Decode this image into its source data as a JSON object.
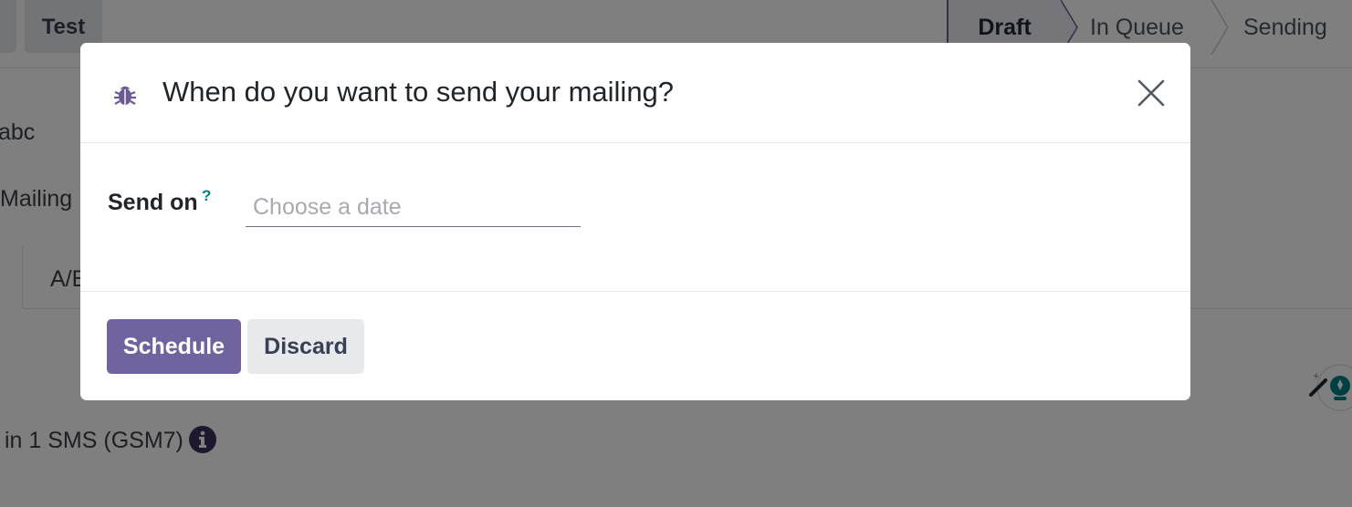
{
  "background": {
    "toolbar": {
      "test_label": "Test"
    },
    "statusbar": {
      "steps": [
        {
          "label": "Draft"
        },
        {
          "label": "In Queue"
        },
        {
          "label": "Sending"
        }
      ]
    },
    "field_fragment_abc": "abc",
    "field_fragment_mailing": "Mailing",
    "tab_fragment": "A/B",
    "sms_info": "in 1 SMS (GSM7)"
  },
  "modal": {
    "title": "When do you want to send your mailing?",
    "title_icon": "bug-icon",
    "close_icon": "close-icon",
    "field": {
      "label": "Send on",
      "help_mark": "?",
      "placeholder": "Choose a date",
      "value": ""
    },
    "buttons": {
      "primary": "Schedule",
      "secondary": "Discard"
    }
  },
  "colors": {
    "primary": "#71639e",
    "help": "#017e84",
    "secondary_bg": "#e7e9ed",
    "backdrop": "rgba(0,0,0,0.5)"
  }
}
